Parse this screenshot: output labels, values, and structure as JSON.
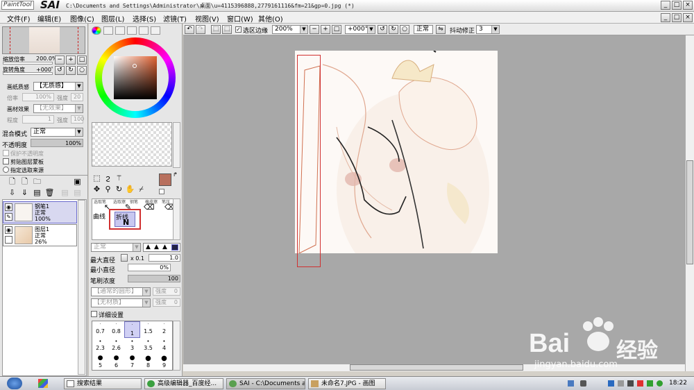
{
  "app": {
    "logo_small": "PaintTool",
    "logo_big": "SAI",
    "window_title": "C:\\Documents and Settings\\Administrator\\桌面\\u=4115396888,2779161116&fm=21&gp=0.jpg (*)"
  },
  "window_controls": {
    "minimize": "_",
    "restore": "□",
    "close": "×"
  },
  "menu": [
    "文件(F)",
    "编辑(E)",
    "图像(C)",
    "图层(L)",
    "选择(S)",
    "滤镜(T)",
    "视图(V)",
    "窗口(W)",
    "其他(O)"
  ],
  "navigator": {
    "zoom_label": "缩放倍率",
    "zoom_value": "200.0%",
    "rotate_label": "旋转角度",
    "rotate_value": "+000゜"
  },
  "paper": {
    "texture_label": "画纸质感",
    "texture_value": "【无质感】",
    "scale_label": "倍率",
    "scale_value": "100%",
    "strength_label": "强度",
    "strength_value": "20",
    "effect_label": "画材效果",
    "effect_value": "【无效果】",
    "degree_label": "程度",
    "degree_value": "1",
    "strength2_label": "强度",
    "strength2_value": "100"
  },
  "layer_props": {
    "blend_label": "混合模式",
    "blend_value": "正常",
    "opacity_label": "不透明度",
    "opacity_value": "100%",
    "opacity_fraction": 1.0,
    "protect_opacity": "保护不透明度",
    "clipping_group": "剪贴图层蒙板",
    "selection_source": "指定选取来源"
  },
  "layers": [
    {
      "name": "钢笔1",
      "mode": "正常",
      "opacity": "100%",
      "selected": true
    },
    {
      "name": "图层1",
      "mode": "正常",
      "opacity": "26%",
      "selected": false
    }
  ],
  "color": {
    "current_color": "#b8705e",
    "secondary_color": "#ffffff",
    "picker_hue_color": "#e06030"
  },
  "tools": {
    "tab_curve": "曲线",
    "tab_polyline": "折线",
    "selected_glyph": "N",
    "row_labels": [
      "选取笔",
      "选取擦",
      "钢笔",
      "橡皮擦",
      "笔压"
    ]
  },
  "brush": {
    "mode_value": "正常",
    "max_size_label": "最大直径",
    "max_size_mult": "x 0.1",
    "max_size_value": "1.0",
    "min_size_label": "最小直径",
    "min_size_value": "0%",
    "density_label": "笔刷浓度",
    "density_value": "100",
    "shape_value": "【通常的圆形】",
    "shape_strength_label": "强度",
    "shape_strength_value": "0",
    "texture_value": "【无材质】",
    "texture_strength_label": "强度",
    "texture_strength_value": "0",
    "detail_label": "详细设置",
    "sizes_row1": [
      "0.7",
      "0.8",
      "1",
      "1.5",
      "2"
    ],
    "sizes_row2": [
      "2.3",
      "2.6",
      "3",
      "3.5",
      "4"
    ],
    "sizes_row3": [
      "5",
      "6",
      "7",
      "8",
      "9"
    ],
    "selected_size": "1"
  },
  "toolbar": {
    "selection_edge_label": "选区边缘",
    "zoom_value": "200%",
    "rotate_value": "+000°",
    "mode_value": "正常",
    "stabilizer_label": "抖动修正",
    "stabilizer_value": "3"
  },
  "taskbar": {
    "tasks": [
      "搜索结果",
      "高级编辑器_百度经...",
      "SAI - C:\\Documents a...",
      "未命名7.JPG - 画图"
    ],
    "clock": "18:22"
  },
  "watermark": {
    "brand": "Bai",
    "brand_tail": "经验",
    "url": "jingyan.baidu.com"
  }
}
